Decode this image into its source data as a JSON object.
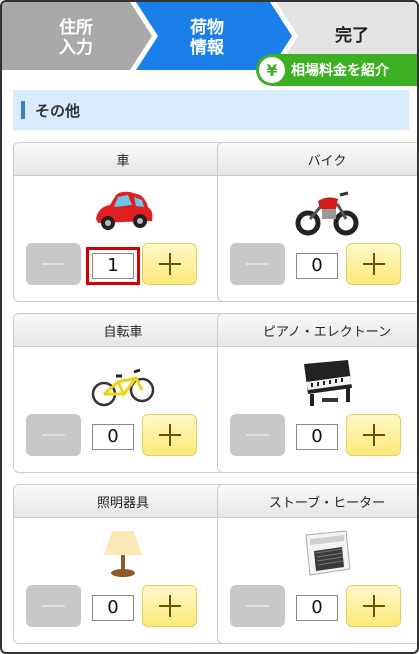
{
  "steps": [
    {
      "label": "住所\n入力",
      "state": "done"
    },
    {
      "label": "荷物\n情報",
      "state": "current"
    },
    {
      "label": "完了",
      "state": "pending"
    }
  ],
  "price_button": {
    "label": "相場料金を紹介",
    "icon": "yen-icon",
    "icon_glyph": "¥"
  },
  "section": {
    "title": "その他"
  },
  "items": [
    {
      "name": "車",
      "qty": "1",
      "icon": "car-icon"
    },
    {
      "name": "バイク",
      "qty": "0",
      "icon": "motorcycle-icon"
    },
    {
      "name": "自転車",
      "qty": "0",
      "icon": "bicycle-icon"
    },
    {
      "name": "ピアノ・エレクトーン",
      "qty": "0",
      "icon": "piano-icon"
    },
    {
      "name": "照明器具",
      "qty": "0",
      "icon": "lamp-icon"
    },
    {
      "name": "ストーブ・ヒーター",
      "qty": "0",
      "icon": "heater-icon"
    }
  ],
  "colors": {
    "step_done": "#a9a9a9",
    "step_current": "#1a7fe8",
    "step_pending": "#e4e4e4",
    "accent_green": "#3cb022"
  }
}
